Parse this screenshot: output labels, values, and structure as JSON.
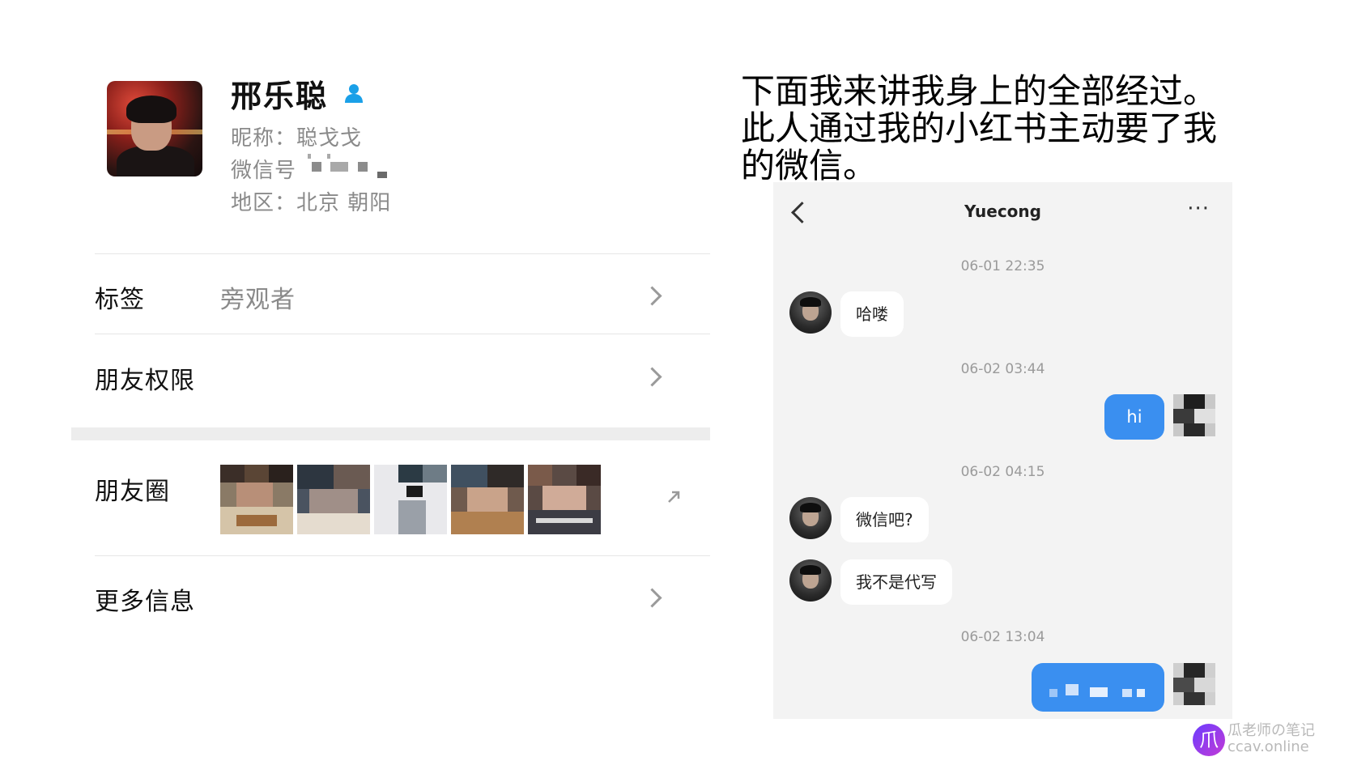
{
  "profile": {
    "name": "邢乐聪",
    "nickname": "昵称：聪戈戈",
    "wechat_id_label": "微信号",
    "region": "地区：北京 朝阳"
  },
  "rows": {
    "tag_label": "标签",
    "tag_value": "旁观者",
    "permissions_label": "朋友权限",
    "moments_label": "朋友圈",
    "more_info_label": "更多信息"
  },
  "caption": {
    "line1": "下面我来讲我身上的全部经过。",
    "line2": "此人通过我的小红书主动要了我",
    "line3": "的微信。"
  },
  "chat": {
    "title": "Yuecong",
    "more": "···",
    "messages": [
      {
        "timestamp": "06-01 22:35",
        "text": "哈喽"
      },
      {
        "timestamp": "06-02 03:44",
        "text": "hi"
      },
      {
        "timestamp": "06-02 04:15",
        "text": "微信吧?"
      },
      {
        "text": "我不是代写"
      },
      {
        "timestamp": "06-02 13:04"
      }
    ]
  },
  "watermark": {
    "logo": "爪",
    "line1": "瓜老师の笔记",
    "line2": "ccav.online"
  },
  "colors": {
    "chat_blue": "#3a8ff0",
    "gender_icon": "#1aa0e8",
    "chat_bg": "#f3f3f3"
  }
}
